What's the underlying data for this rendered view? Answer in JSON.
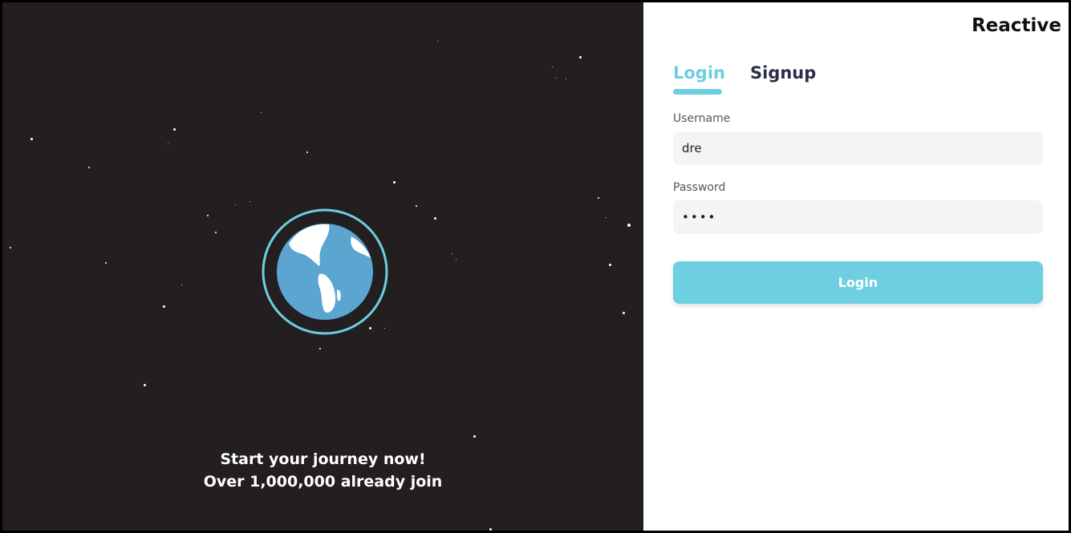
{
  "brand": {
    "name": "Reactive"
  },
  "tabs": [
    {
      "label": "Login",
      "active": true
    },
    {
      "label": "Signup",
      "active": false
    }
  ],
  "form": {
    "username_label": "Username",
    "username_value": "dre",
    "password_label": "Password",
    "password_value": "••••",
    "submit_label": "Login"
  },
  "hero": {
    "tagline_line1": "Start your journey now!",
    "tagline_line2": "Over 1,000,000 already join",
    "icon": "globe-icon"
  },
  "colors": {
    "accent": "#6dcfe0",
    "hero_background": "#231f20",
    "tab_inactive": "#2b2d4a",
    "input_background": "#f4f4f7"
  }
}
